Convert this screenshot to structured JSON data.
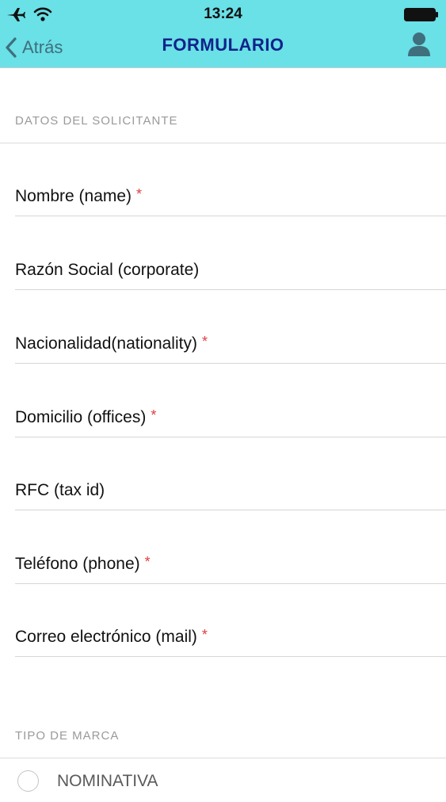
{
  "status_bar": {
    "time": "13:24",
    "icons": [
      "airplane-icon",
      "wifi-icon",
      "battery-icon"
    ]
  },
  "nav": {
    "back_label": "Atrás",
    "title": "FORMULARIO",
    "profile_icon": "person-icon"
  },
  "colors": {
    "header_bg": "#6ae0e7",
    "title": "#10238a",
    "required": "#e23c3c"
  },
  "sections": {
    "applicant": "DATOS DEL SOLICITANTE",
    "brand_type": "TIPO DE MARCA"
  },
  "fields": [
    {
      "label": "Nombre (name)",
      "required_mark": "*"
    },
    {
      "label": "Razón Social (corporate)",
      "required_mark": ""
    },
    {
      "label": "Nacionalidad(nationality)",
      "required_mark": "*"
    },
    {
      "label": "Domicilio (offices)",
      "required_mark": "*"
    },
    {
      "label": "RFC (tax id)",
      "required_mark": ""
    },
    {
      "label": "Teléfono (phone)",
      "required_mark": "*"
    },
    {
      "label": "Correo electrónico (mail)",
      "required_mark": "*"
    }
  ],
  "brand_options": [
    {
      "label": "NOMINATIVA",
      "selected": false
    }
  ]
}
